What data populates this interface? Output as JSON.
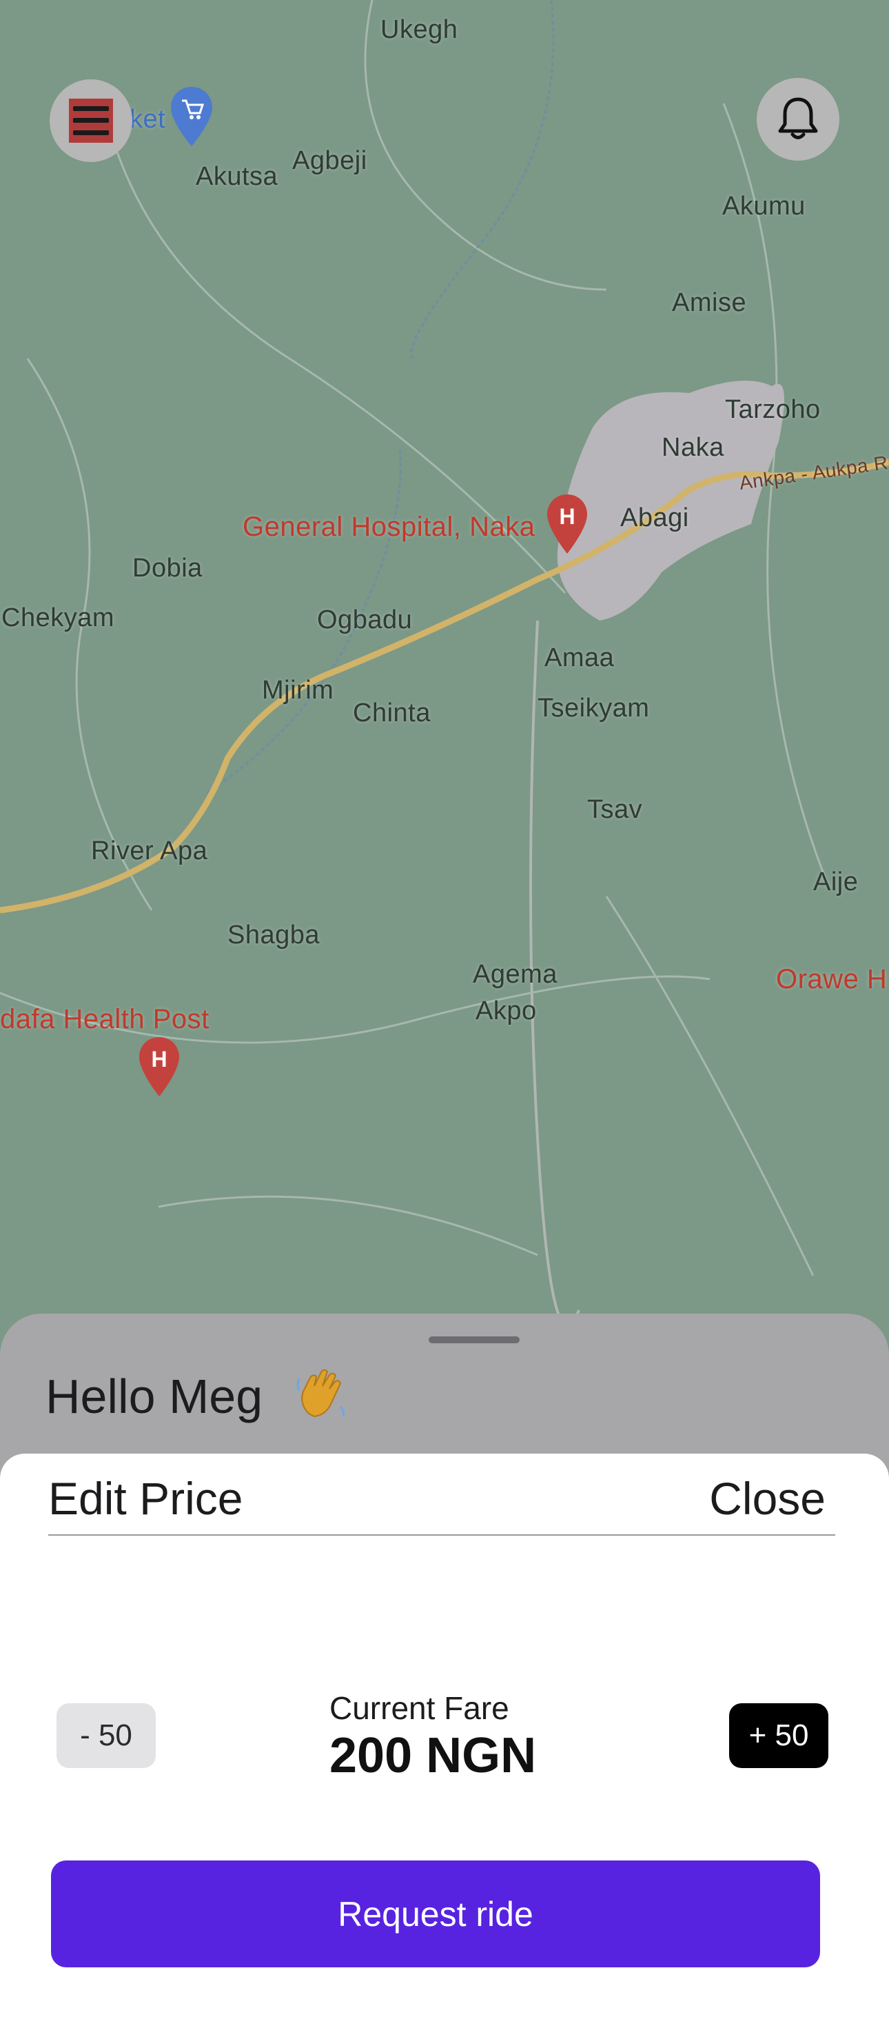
{
  "map": {
    "places": [
      "Ukegh",
      "Agbeji",
      "Akutsa",
      "Akumu",
      "Amise",
      "Tarzoho",
      "Naka",
      "Abagi",
      "Dobia",
      "Chekyam",
      "Ogbadu",
      "Mjirim",
      "Chinta",
      "Amaa",
      "Tseikyam",
      "Tsav",
      "Aije",
      "River Apa",
      "Shagba",
      "Agema",
      "Akpo"
    ],
    "pois": [
      "General Hospital, Naka",
      "dafa Health Post",
      "Orawe H",
      "ket"
    ],
    "road_label": "Ankpa - Aukpa R",
    "colors": {
      "land": "#7c9886",
      "road": "#d1b36a",
      "town": "#b8b6ba",
      "poi": "#c0392b"
    }
  },
  "header": {
    "menu_icon": "menu-icon",
    "bell_icon": "bell-icon"
  },
  "sheet": {
    "greeting": "Hello Meg",
    "greeting_emoji": "waving-hand-icon"
  },
  "edit_price": {
    "title": "Edit Price",
    "close_label": "Close",
    "minus_label": "- 50",
    "plus_label": "+ 50",
    "fare_label": "Current Fare",
    "fare_value": "200 NGN",
    "request_label": "Request ride",
    "accent_color": "#5723e0"
  }
}
